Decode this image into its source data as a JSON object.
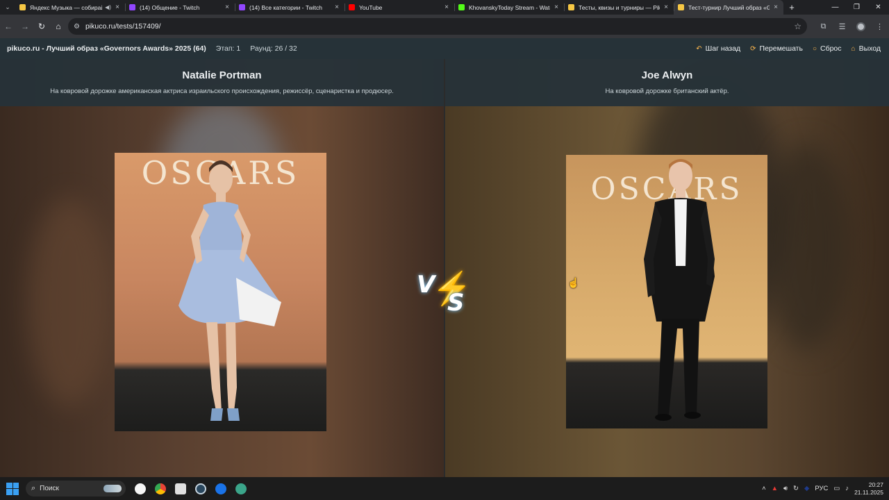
{
  "browser": {
    "tabs": [
      {
        "title": "Яндекс Музыка — собирайте",
        "favicon_color": "#f6c744",
        "audio": true,
        "active": false
      },
      {
        "title": "(14) Общение - Twitch",
        "favicon_color": "#9146ff",
        "audio": false,
        "active": false
      },
      {
        "title": "(14) Все категории - Twitch",
        "favicon_color": "#9146ff",
        "audio": false,
        "active": false
      },
      {
        "title": "YouTube",
        "favicon_color": "#ff0000",
        "audio": false,
        "active": false
      },
      {
        "title": "KhovanskyToday Stream - Watch",
        "favicon_color": "#53fc18",
        "audio": false,
        "active": false
      },
      {
        "title": "Тесты, квизы и турниры — Pikuco",
        "favicon_color": "#f6c744",
        "audio": false,
        "active": false
      },
      {
        "title": "Тест-турнир Лучший образ «Governors",
        "favicon_color": "#f6c744",
        "audio": false,
        "active": true
      }
    ],
    "url": "pikuco.ru/tests/157409/"
  },
  "header": {
    "title": "pikuco.ru - Лучший образ «Governors Awards» 2025 (64)",
    "stage": "Этап: 1",
    "round": "Раунд: 26 / 32",
    "actions": {
      "back": "Шаг назад",
      "shuffle": "Перемешать",
      "reset": "Сброс",
      "exit": "Выход"
    }
  },
  "contest": {
    "left": {
      "name": "Natalie Portman",
      "description": "На ковровой дорожке американская актриса израильского происхождения, режиссёр, сценаристка и продюсер.",
      "backdrop_text": "OSCARS"
    },
    "right": {
      "name": "Joe Alwyn",
      "description": "На ковровой дорожке британский актёр.",
      "backdrop_text": "OSCARS"
    },
    "vs": {
      "v": "V",
      "s": "S"
    }
  },
  "taskbar": {
    "search_placeholder": "Поиск",
    "language": "РУС",
    "time": "20:27",
    "date": "21.11.2025"
  }
}
